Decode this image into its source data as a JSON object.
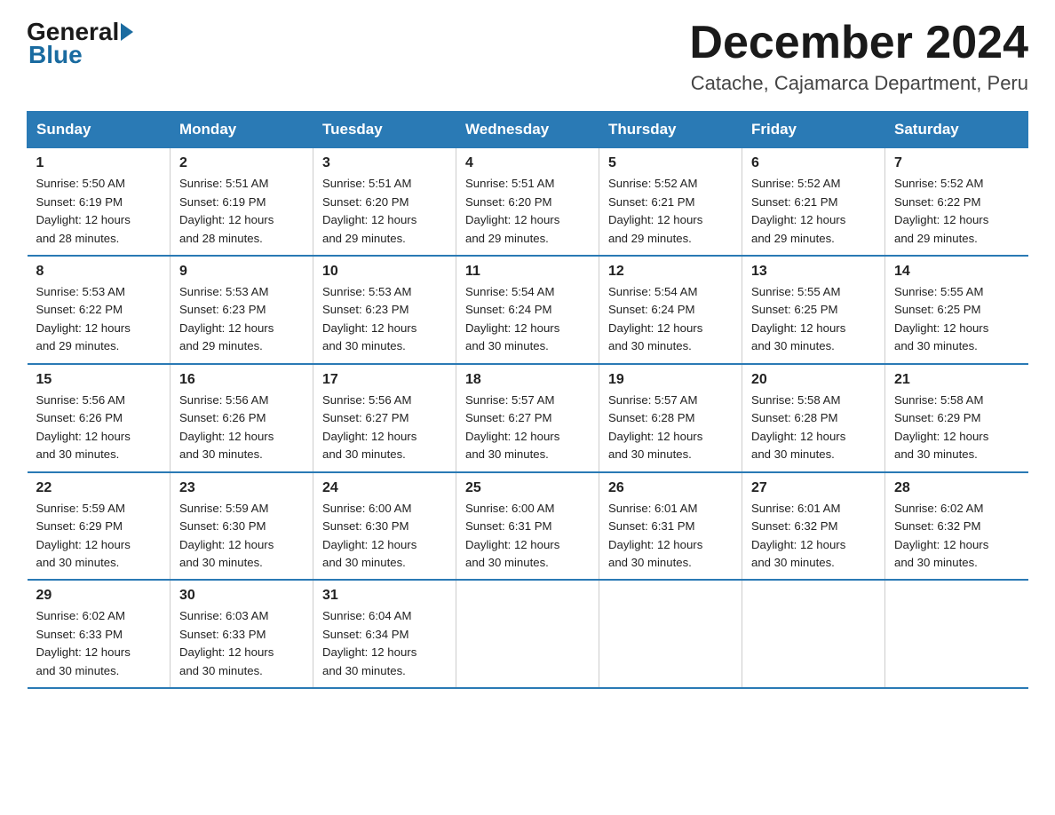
{
  "header": {
    "logo_general": "General",
    "logo_blue": "Blue",
    "title": "December 2024",
    "subtitle": "Catache, Cajamarca Department, Peru"
  },
  "days_of_week": [
    "Sunday",
    "Monday",
    "Tuesday",
    "Wednesday",
    "Thursday",
    "Friday",
    "Saturday"
  ],
  "weeks": [
    [
      {
        "num": "1",
        "sunrise": "5:50 AM",
        "sunset": "6:19 PM",
        "daylight": "12 hours and 28 minutes."
      },
      {
        "num": "2",
        "sunrise": "5:51 AM",
        "sunset": "6:19 PM",
        "daylight": "12 hours and 28 minutes."
      },
      {
        "num": "3",
        "sunrise": "5:51 AM",
        "sunset": "6:20 PM",
        "daylight": "12 hours and 29 minutes."
      },
      {
        "num": "4",
        "sunrise": "5:51 AM",
        "sunset": "6:20 PM",
        "daylight": "12 hours and 29 minutes."
      },
      {
        "num": "5",
        "sunrise": "5:52 AM",
        "sunset": "6:21 PM",
        "daylight": "12 hours and 29 minutes."
      },
      {
        "num": "6",
        "sunrise": "5:52 AM",
        "sunset": "6:21 PM",
        "daylight": "12 hours and 29 minutes."
      },
      {
        "num": "7",
        "sunrise": "5:52 AM",
        "sunset": "6:22 PM",
        "daylight": "12 hours and 29 minutes."
      }
    ],
    [
      {
        "num": "8",
        "sunrise": "5:53 AM",
        "sunset": "6:22 PM",
        "daylight": "12 hours and 29 minutes."
      },
      {
        "num": "9",
        "sunrise": "5:53 AM",
        "sunset": "6:23 PM",
        "daylight": "12 hours and 29 minutes."
      },
      {
        "num": "10",
        "sunrise": "5:53 AM",
        "sunset": "6:23 PM",
        "daylight": "12 hours and 30 minutes."
      },
      {
        "num": "11",
        "sunrise": "5:54 AM",
        "sunset": "6:24 PM",
        "daylight": "12 hours and 30 minutes."
      },
      {
        "num": "12",
        "sunrise": "5:54 AM",
        "sunset": "6:24 PM",
        "daylight": "12 hours and 30 minutes."
      },
      {
        "num": "13",
        "sunrise": "5:55 AM",
        "sunset": "6:25 PM",
        "daylight": "12 hours and 30 minutes."
      },
      {
        "num": "14",
        "sunrise": "5:55 AM",
        "sunset": "6:25 PM",
        "daylight": "12 hours and 30 minutes."
      }
    ],
    [
      {
        "num": "15",
        "sunrise": "5:56 AM",
        "sunset": "6:26 PM",
        "daylight": "12 hours and 30 minutes."
      },
      {
        "num": "16",
        "sunrise": "5:56 AM",
        "sunset": "6:26 PM",
        "daylight": "12 hours and 30 minutes."
      },
      {
        "num": "17",
        "sunrise": "5:56 AM",
        "sunset": "6:27 PM",
        "daylight": "12 hours and 30 minutes."
      },
      {
        "num": "18",
        "sunrise": "5:57 AM",
        "sunset": "6:27 PM",
        "daylight": "12 hours and 30 minutes."
      },
      {
        "num": "19",
        "sunrise": "5:57 AM",
        "sunset": "6:28 PM",
        "daylight": "12 hours and 30 minutes."
      },
      {
        "num": "20",
        "sunrise": "5:58 AM",
        "sunset": "6:28 PM",
        "daylight": "12 hours and 30 minutes."
      },
      {
        "num": "21",
        "sunrise": "5:58 AM",
        "sunset": "6:29 PM",
        "daylight": "12 hours and 30 minutes."
      }
    ],
    [
      {
        "num": "22",
        "sunrise": "5:59 AM",
        "sunset": "6:29 PM",
        "daylight": "12 hours and 30 minutes."
      },
      {
        "num": "23",
        "sunrise": "5:59 AM",
        "sunset": "6:30 PM",
        "daylight": "12 hours and 30 minutes."
      },
      {
        "num": "24",
        "sunrise": "6:00 AM",
        "sunset": "6:30 PM",
        "daylight": "12 hours and 30 minutes."
      },
      {
        "num": "25",
        "sunrise": "6:00 AM",
        "sunset": "6:31 PM",
        "daylight": "12 hours and 30 minutes."
      },
      {
        "num": "26",
        "sunrise": "6:01 AM",
        "sunset": "6:31 PM",
        "daylight": "12 hours and 30 minutes."
      },
      {
        "num": "27",
        "sunrise": "6:01 AM",
        "sunset": "6:32 PM",
        "daylight": "12 hours and 30 minutes."
      },
      {
        "num": "28",
        "sunrise": "6:02 AM",
        "sunset": "6:32 PM",
        "daylight": "12 hours and 30 minutes."
      }
    ],
    [
      {
        "num": "29",
        "sunrise": "6:02 AM",
        "sunset": "6:33 PM",
        "daylight": "12 hours and 30 minutes."
      },
      {
        "num": "30",
        "sunrise": "6:03 AM",
        "sunset": "6:33 PM",
        "daylight": "12 hours and 30 minutes."
      },
      {
        "num": "31",
        "sunrise": "6:04 AM",
        "sunset": "6:34 PM",
        "daylight": "12 hours and 30 minutes."
      },
      null,
      null,
      null,
      null
    ]
  ],
  "labels": {
    "sunrise_prefix": "Sunrise: ",
    "sunset_prefix": "Sunset: ",
    "daylight_prefix": "Daylight: "
  }
}
